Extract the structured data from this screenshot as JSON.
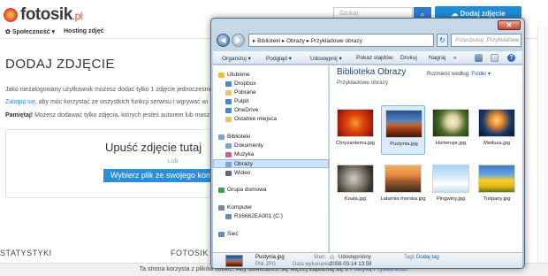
{
  "site": {
    "logo_text": "fotosik",
    "logo_tld": ".pl",
    "search_placeholder": "Szukaj",
    "add_photo_label": "Dodaj zdjęcie",
    "nav": {
      "community": "Społeczność ▾",
      "hosting": "Hosting zdjęć"
    },
    "page_title": "DODAJ ZDJĘCIE",
    "info_line1": "Jako niezalogowany użytkownik możesz dodać tylko 1 zdjęcie jednocześnie",
    "info_login": "Zaloguj się",
    "info_line2": ", aby móc korzystać ze wszystkich funkcji serwisu i wgrywać wi",
    "info_remember": "Pamiętaj!",
    "info_line3": " Możesz dodawać tylko zdjęcia, których jesteś autorem lub masz",
    "upload_title": "Upuść zdjęcie tutaj",
    "upload_or": "LUB",
    "upload_button": "Wybierz plik ze swojego kompu",
    "section_stats": "STATYSTYKI",
    "section_fotosik": "FOTOSIK",
    "cookie_text": "Ta strona korzysta z plików cookie. Aby dowiedzieć się więcej zapoznaj się z ",
    "cookie_link": "Polityką Prywatności."
  },
  "explorer": {
    "close_glyph": "✕",
    "back_glyph": "◀",
    "forward_glyph": "▶",
    "breadcrumb": "▸ Biblioteki ▸ Obrazy ▸ Przykładowe obrazy",
    "refresh_glyph": "↻",
    "search_placeholder": "Przeszukaj: Przykładowe o...",
    "toolbar": {
      "organize": "Organizuj ▾",
      "preview": "Podgląd ▾",
      "share": "Udostępnij ▾",
      "slideshow": "Pokaz slajdów",
      "print": "Drukuj",
      "burn": "Nagraj",
      "more": "»",
      "help": "?"
    },
    "nav_tree": [
      {
        "label": "Ulubione",
        "icon": "star-icon"
      },
      {
        "label": "Dropbox",
        "icon": "dropbox-icon"
      },
      {
        "label": "Pobrane",
        "icon": "downloads-folder-icon"
      },
      {
        "label": "Pulpit",
        "icon": "desktop-icon"
      },
      {
        "label": "OneDrive",
        "icon": "onedrive-icon"
      },
      {
        "label": "Ostatnie miejsca",
        "icon": "recent-places-icon"
      },
      {
        "label": "Biblioteki",
        "icon": "libraries-icon"
      },
      {
        "label": "Dokumenty",
        "icon": "documents-icon"
      },
      {
        "label": "Muzyka",
        "icon": "music-icon"
      },
      {
        "label": "Obrazy",
        "icon": "pictures-icon"
      },
      {
        "label": "Wideo",
        "icon": "video-icon"
      },
      {
        "label": "Grupa domowa",
        "icon": "homegroup-icon"
      },
      {
        "label": "Komputer",
        "icon": "computer-icon"
      },
      {
        "label": "R16662EA001 (C:)",
        "icon": "drive-icon"
      },
      {
        "label": "Sieć",
        "icon": "network-icon"
      }
    ],
    "library_title": "Biblioteka Obrazy",
    "library_subtitle": "Przykładowe obrazy",
    "arrange_label": "Rozmieść według:",
    "arrange_value": "Folder ▾",
    "files": [
      {
        "name": "Chryzantema.jpg"
      },
      {
        "name": "Pustynia.jpg"
      },
      {
        "name": "Hortensje.jpg"
      },
      {
        "name": "Meduza.jpg"
      },
      {
        "name": "Koala.jpg"
      },
      {
        "name": "Latarnia morska.jpg"
      },
      {
        "name": "Pingwiny.jpg"
      },
      {
        "name": "Tulipany.jpg"
      }
    ],
    "selected_file": "Pustynia.jpg",
    "details": {
      "name": "Pustynia.jpg",
      "type": "Plik JPG",
      "state_key": "Stan:",
      "state_value": "Udostępniony",
      "date_key": "Data wykonania:",
      "date_value": "2008-03-14 13:59",
      "tags_key": "Tagi:",
      "tags_value": "Dodaj tag"
    }
  }
}
